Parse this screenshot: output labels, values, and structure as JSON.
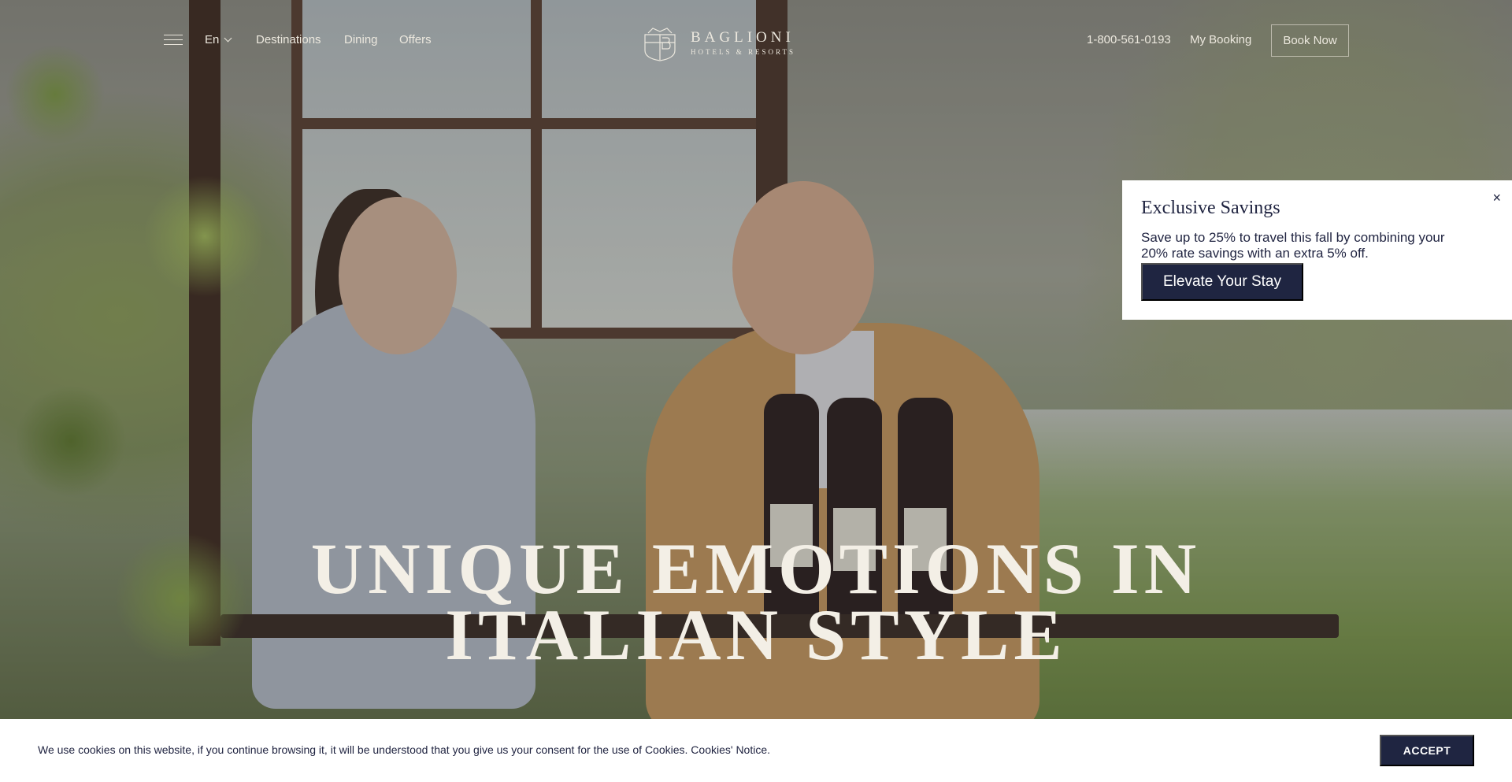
{
  "header": {
    "language": "En",
    "nav": [
      "Destinations",
      "Dining",
      "Offers"
    ],
    "logo": {
      "name": "BAGLIONI",
      "sub": "HOTELS & RESORTS"
    },
    "phone": "1-800-561-0193",
    "my_booking": "My Booking",
    "book_now": "Book Now"
  },
  "hero": {
    "headline_line1": "UNIQUE EMOTIONS IN",
    "headline_line2": "ITALIAN STYLE"
  },
  "popup": {
    "title": "Exclusive Savings",
    "description": "Save up to 25% to travel this fall by combining your 20% rate savings with an extra 5% off.",
    "cta": "Elevate Your Stay",
    "close": "×"
  },
  "cookie_bar": {
    "text": "We use cookies on this website, if you continue browsing it, it will be understood that you give us your consent for the use of Cookies. Cookies' Notice.",
    "accept": "ACCEPT"
  },
  "colors": {
    "navy": "#1f2541",
    "header_text": "#ece8de"
  },
  "icons": [
    "menu-icon",
    "chevron-down-icon",
    "logo-crest-icon",
    "close-icon"
  ]
}
